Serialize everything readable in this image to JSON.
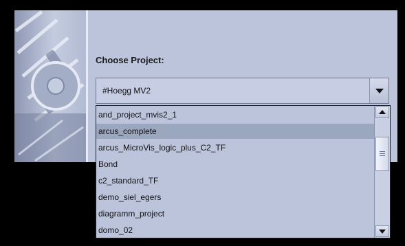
{
  "dialog": {
    "label": "Choose Project:"
  },
  "project_combo": {
    "value": "#Hoegg MV2"
  },
  "project_list": {
    "items": [
      "and_project_mvis2_1",
      "arcus_complete",
      "arcus_MicroVis_logic_plus_C2_TF",
      "Bond",
      "c2_standard_TF",
      "demo_siel_egers",
      "diagramm_project",
      "domo_02"
    ],
    "selected_index": 1
  },
  "icons": {
    "combo_arrow": "chevron-down-icon",
    "scroll_up": "arrow-up-icon",
    "scroll_down": "arrow-down-icon",
    "decoration": "gear-icon"
  },
  "colors": {
    "dialog_background": "#bcc4dc",
    "selection": "#9aa7bf"
  }
}
